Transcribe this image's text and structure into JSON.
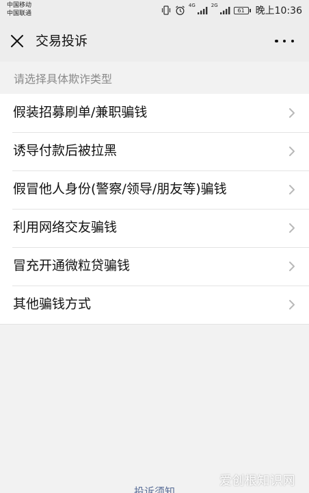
{
  "status_bar": {
    "carriers": [
      "中国移动",
      "中国联通"
    ],
    "net_1": "4G",
    "net_2": "2G",
    "battery": "61",
    "time": "晚上10:36"
  },
  "header": {
    "title": "交易投诉"
  },
  "section": {
    "label": "请选择具体欺诈类型"
  },
  "items": [
    {
      "label": "假装招募刷单/兼职骗钱"
    },
    {
      "label": "诱导付款后被拉黑"
    },
    {
      "label": "假冒他人身份(警察/领导/朋友等)骗钱"
    },
    {
      "label": "利用网络交友骗钱"
    },
    {
      "label": "冒充开通微粒贷骗钱"
    },
    {
      "label": "其他骗钱方式"
    }
  ],
  "footer": {
    "link": "投诉须知"
  },
  "watermark": {
    "text": "爱创根知识网"
  },
  "colors": {
    "header_bg": "#ededed",
    "page_bg": "#f2f2f2",
    "link": "#576b95"
  }
}
